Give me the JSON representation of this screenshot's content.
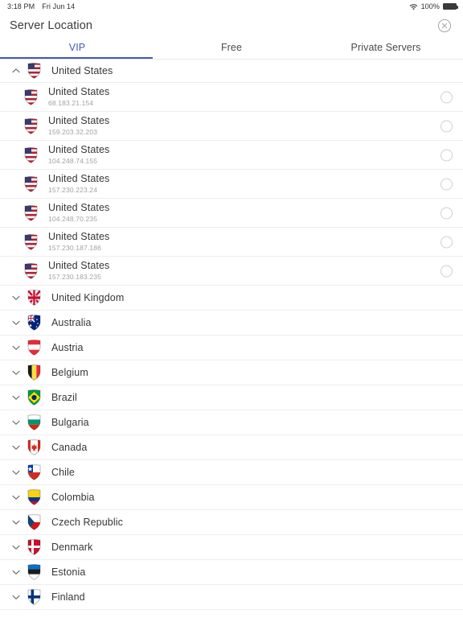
{
  "statusbar": {
    "time": "3:18 PM",
    "date": "Fri Jun 14",
    "wifi_icon": "wifi-icon",
    "battery_percent": "100%",
    "battery_icon": "battery-icon"
  },
  "header": {
    "title": "Server Location",
    "close_icon": "close-circle-icon"
  },
  "tabs": {
    "active_index": 0,
    "accent_color": "#4355c7",
    "items": [
      {
        "label": "VIP"
      },
      {
        "label": "Free"
      },
      {
        "label": "Private Servers"
      }
    ]
  },
  "list": [
    {
      "kind": "group",
      "name": "United States",
      "flag": "flag-us",
      "expanded": true,
      "chevron_icon": "chevron-up-icon"
    },
    {
      "kind": "server",
      "name": "United States",
      "ip": "68.183.21.154",
      "flag": "flag-us",
      "selected": false
    },
    {
      "kind": "server",
      "name": "United States",
      "ip": "159.203.32.203",
      "flag": "flag-us",
      "selected": false
    },
    {
      "kind": "server",
      "name": "United States",
      "ip": "104.248.74.155",
      "flag": "flag-us",
      "selected": false
    },
    {
      "kind": "server",
      "name": "United States",
      "ip": "157.230.223.24",
      "flag": "flag-us",
      "selected": false
    },
    {
      "kind": "server",
      "name": "United States",
      "ip": "104.248.70.235",
      "flag": "flag-us",
      "selected": false
    },
    {
      "kind": "server",
      "name": "United States",
      "ip": "157.230.187.186",
      "flag": "flag-us",
      "selected": false
    },
    {
      "kind": "server",
      "name": "United States",
      "ip": "157.230.183.235",
      "flag": "flag-us",
      "selected": false
    },
    {
      "kind": "country",
      "name": "United Kingdom",
      "flag": "flag-gb",
      "expanded": false,
      "chevron_icon": "chevron-down-icon"
    },
    {
      "kind": "country",
      "name": "Australia",
      "flag": "flag-au",
      "expanded": false,
      "chevron_icon": "chevron-down-icon"
    },
    {
      "kind": "country",
      "name": "Austria",
      "flag": "flag-at",
      "expanded": false,
      "chevron_icon": "chevron-down-icon"
    },
    {
      "kind": "country",
      "name": "Belgium",
      "flag": "flag-be",
      "expanded": false,
      "chevron_icon": "chevron-down-icon"
    },
    {
      "kind": "country",
      "name": "Brazil",
      "flag": "flag-br",
      "expanded": false,
      "chevron_icon": "chevron-down-icon"
    },
    {
      "kind": "country",
      "name": "Bulgaria",
      "flag": "flag-bg",
      "expanded": false,
      "chevron_icon": "chevron-down-icon"
    },
    {
      "kind": "country",
      "name": "Canada",
      "flag": "flag-ca",
      "expanded": false,
      "chevron_icon": "chevron-down-icon"
    },
    {
      "kind": "country",
      "name": "Chile",
      "flag": "flag-cl",
      "expanded": false,
      "chevron_icon": "chevron-down-icon"
    },
    {
      "kind": "country",
      "name": "Colombia",
      "flag": "flag-co",
      "expanded": false,
      "chevron_icon": "chevron-down-icon"
    },
    {
      "kind": "country",
      "name": "Czech Republic",
      "flag": "flag-cz",
      "expanded": false,
      "chevron_icon": "chevron-down-icon"
    },
    {
      "kind": "country",
      "name": "Denmark",
      "flag": "flag-dk",
      "expanded": false,
      "chevron_icon": "chevron-down-icon"
    },
    {
      "kind": "country",
      "name": "Estonia",
      "flag": "flag-ee",
      "expanded": false,
      "chevron_icon": "chevron-down-icon"
    },
    {
      "kind": "country",
      "name": "Finland",
      "flag": "flag-fi",
      "expanded": false,
      "chevron_icon": "chevron-down-icon"
    }
  ]
}
